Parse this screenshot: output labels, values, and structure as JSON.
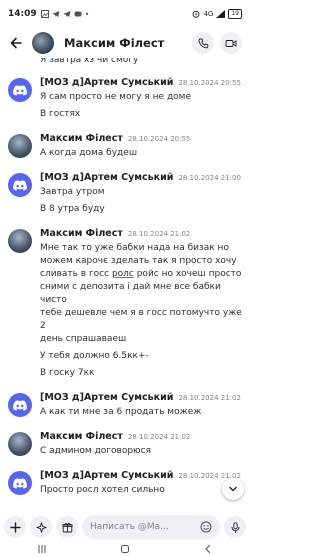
{
  "status_bar": {
    "time": "14:09",
    "network": "4G",
    "battery": "19"
  },
  "header": {
    "name": "Максим Філест"
  },
  "messages": {
    "top_cont": "Я завтра хз чи смогу",
    "m1": {
      "author": "[МОЗ д]Артем Сумський",
      "time": "28.10.2024 20:55",
      "lines": [
        "Я сам просто не могу я не доме",
        "В гостях"
      ]
    },
    "m2": {
      "author": "Максим Філест",
      "time": "28.10.2024 20:55",
      "lines": [
        "А когда дома будеш"
      ]
    },
    "m3": {
      "author": "[МОЗ д]Артем Сумський",
      "time": "28.10.2024 21:00",
      "lines": [
        "Завтра утром",
        "В 8 утра буду"
      ]
    },
    "m4": {
      "author": "Максим Філест",
      "time": "28.10.2024 21:02",
      "p1a": "Мне так то уже бабки нада на бизак но",
      "p1b": "можем карочє зделать так я просто хочу",
      "p1c_pre": "сливать в госс ",
      "p1c_link": "ролс",
      "p1c_post": " ройс но хочеш просто",
      "p1d": "сними с депозита і дай мне все бабки чисто",
      "p1e": "тебе дешевле чем я в госс потомучто уже 2",
      "p1f": "день спрашаваеш",
      "p2": "У тебя должно 6.5кк+-",
      "p3": "В госку 7кк"
    },
    "m5": {
      "author": "[МОЗ д]Артем Сумський",
      "time": "28.10.2024 21:02",
      "lines": [
        "А как ти мне за 6 продать можеж"
      ]
    },
    "m6": {
      "author": "Максим Філест",
      "time": "28.10.2024 21:02",
      "lines": [
        "С админом договорюся"
      ]
    },
    "m7": {
      "author": "[МОЗ д]Артем Сумський",
      "time": "28.10.2024 21:02",
      "lines": [
        "Просто росл хотел сильно"
      ]
    }
  },
  "input": {
    "placeholder": "Написать @Ma..."
  },
  "icons": {
    "back": "arrow-left-icon",
    "call": "phone-icon",
    "video": "video-camera-icon",
    "add": "plus-icon",
    "apps": "apps-icon",
    "gift": "gift-icon",
    "emoji": "emoji-icon",
    "mic": "microphone-icon",
    "scroll": "chevron-down-icon"
  },
  "colors": {
    "discord_blurple": "#5865f2",
    "text": "#1e1f22",
    "muted": "#80848e",
    "input_bg": "#eef0f3"
  }
}
